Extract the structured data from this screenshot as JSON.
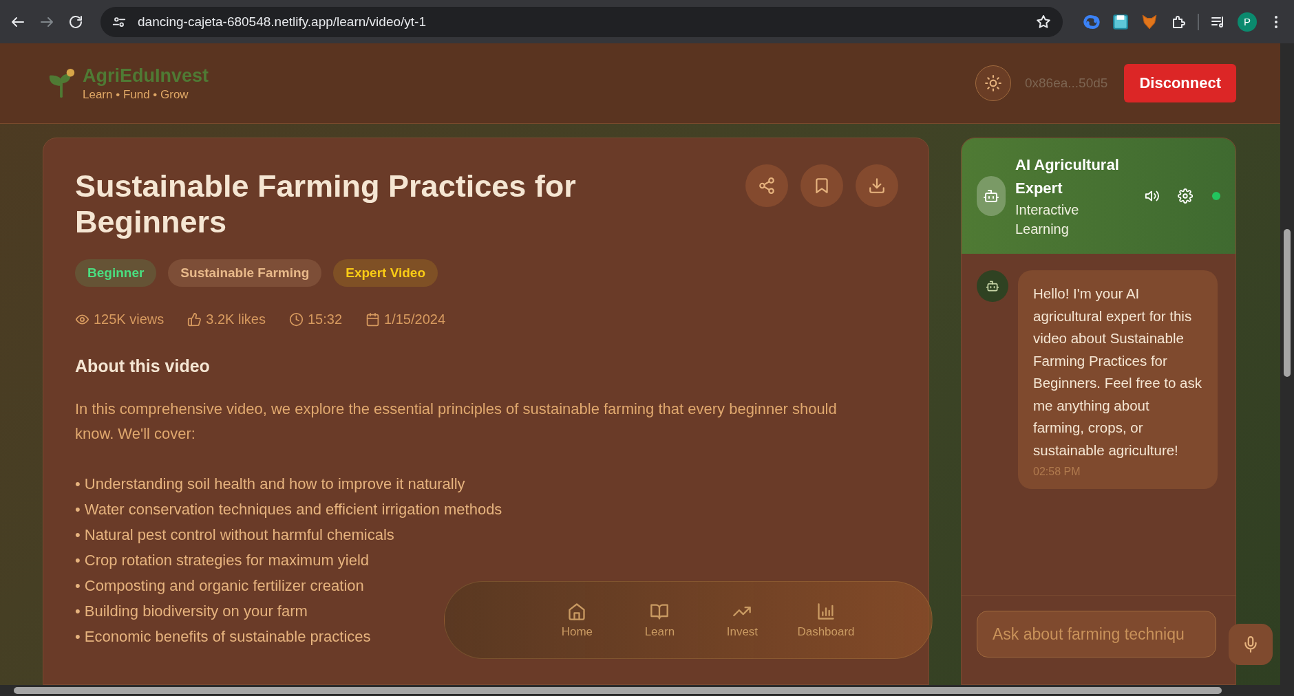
{
  "browser": {
    "url": "dancing-cajeta-680548.netlify.app/learn/video/yt-1",
    "profile_initial": "P"
  },
  "header": {
    "brand": "AgriEduInvest",
    "tagline": "Learn • Fund • Grow",
    "wallet": "0x86ea...50d5",
    "disconnect": "Disconnect"
  },
  "video": {
    "title": "Sustainable Farming Practices for Beginners",
    "tags": [
      {
        "label": "Beginner",
        "color": "#4ade80"
      },
      {
        "label": "Sustainable Farming",
        "color": "#e8b98a"
      },
      {
        "label": "Expert Video",
        "color": "#facc15"
      }
    ],
    "meta": [
      {
        "kind": "views",
        "text": "125K views"
      },
      {
        "kind": "likes",
        "text": "3.2K likes"
      },
      {
        "kind": "duration",
        "text": "15:32"
      },
      {
        "kind": "date",
        "text": "1/15/2024"
      }
    ],
    "about_heading": "About this video",
    "intro": "In this comprehensive video, we explore the essential principles of sustainable farming that every beginner should know. We'll cover:",
    "bullets": [
      "• Understanding soil health and how to improve it naturally",
      "• Water conservation techniques and efficient irrigation methods",
      "• Natural pest control without harmful chemicals",
      "• Crop rotation strategies for maximum yield",
      "• Composting and organic fertilizer creation",
      "• Building biodiversity on your farm",
      "• Economic benefits of sustainable practices"
    ]
  },
  "chat": {
    "title": "AI Agricultural Expert",
    "subtitle": "Interactive Learning",
    "online": true,
    "messages": [
      {
        "text": "Hello! I'm your AI agricultural expert for this video about Sustainable Farming Practices for Beginners. Feel free to ask me anything about farming, crops, or sustainable agriculture!",
        "time": "02:58 PM"
      }
    ],
    "input": {
      "placeholder": "Ask about farming techniqu"
    }
  },
  "bottom_nav": [
    {
      "kind": "home",
      "label": "Home"
    },
    {
      "kind": "learn",
      "label": "Learn"
    },
    {
      "kind": "invest",
      "label": "Invest"
    },
    {
      "kind": "dashboard",
      "label": "Dashboard"
    }
  ]
}
